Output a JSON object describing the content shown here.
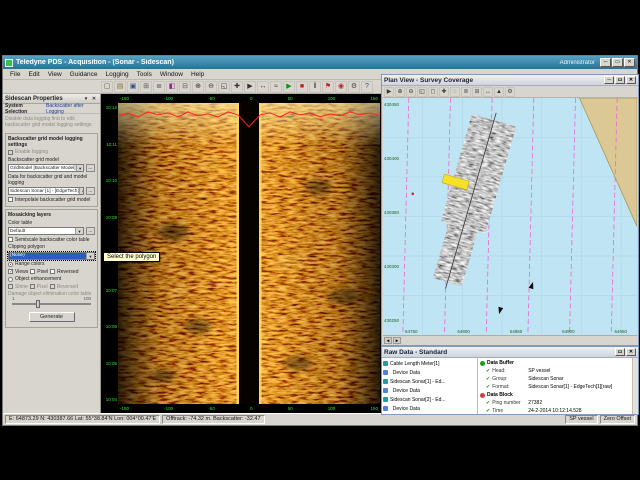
{
  "window": {
    "title": "Teledyne PDS - Acquisition - (Sonar - Sidescan)",
    "user": "Administrator"
  },
  "chrome": {
    "min": "─",
    "max": "▭",
    "close": "✕"
  },
  "menu": {
    "items": [
      "File",
      "Edit",
      "View",
      "Guidance",
      "Logging",
      "Tools",
      "Window",
      "Help"
    ]
  },
  "toolbar": {
    "icons": [
      {
        "name": "new-file-icon",
        "glyph": "▢",
        "color": "#555555"
      },
      {
        "name": "open-file-icon",
        "glyph": "▤",
        "color": "#8a6a20"
      },
      {
        "name": "save-icon",
        "glyph": "▣",
        "color": "#2a4f8a"
      },
      {
        "name": "print-icon",
        "glyph": "⊞",
        "color": "#555555"
      },
      {
        "name": "layers-icon",
        "glyph": "≣",
        "color": "#555555"
      },
      {
        "name": "palette-icon",
        "glyph": "◧",
        "color": "#8a2a8a"
      },
      {
        "name": "grid-icon",
        "glyph": "⊟",
        "color": "#555555"
      },
      {
        "name": "zoom-in-icon",
        "glyph": "⊕",
        "color": "#333333"
      },
      {
        "name": "zoom-out-icon",
        "glyph": "⊖",
        "color": "#333333"
      },
      {
        "name": "zoom-extents-icon",
        "glyph": "◱",
        "color": "#333333"
      },
      {
        "name": "pan-icon",
        "glyph": "✚",
        "color": "#333333"
      },
      {
        "name": "select-icon",
        "glyph": "▶",
        "color": "#333333"
      },
      {
        "name": "measure-icon",
        "glyph": "↔",
        "color": "#333333"
      },
      {
        "name": "profile-icon",
        "glyph": "≈",
        "color": "#333333"
      },
      {
        "name": "start-logging-icon",
        "glyph": "▶",
        "color": "#149114"
      },
      {
        "name": "stop-logging-icon",
        "glyph": "■",
        "color": "#bb2222"
      },
      {
        "name": "pause-logging-icon",
        "glyph": "‖",
        "color": "#333333"
      },
      {
        "name": "event-flag-icon",
        "glyph": "⚑",
        "color": "#bb2222"
      },
      {
        "name": "alarm-icon",
        "glyph": "◉",
        "color": "#bb2222"
      },
      {
        "name": "settings-icon",
        "glyph": "⚙",
        "color": "#444444"
      },
      {
        "name": "help-icon",
        "glyph": "?",
        "color": "#2a4f8a"
      }
    ]
  },
  "properties_panel": {
    "title": "Sidescan Properties",
    "tab_system": "System Selection",
    "tab_backscatter": "Backscatter after Logging",
    "intro": "Disable data logging first to edit backscatter grid model logging settings.",
    "logging_group": {
      "title": "Backscatter grid model logging settings",
      "enable_logging": "Enable logging",
      "model_label": "Backscatter grid model",
      "model_value": "GridModel [Backscatter Model]",
      "model_button": "...",
      "data_label": "Data for backscatter grid and model logging",
      "data_value": "Sidescan Sonar [1] - [EdgeTech]",
      "data_button": "...",
      "interpolate": "Interpolate backscatter grid model"
    },
    "mosaic_group": {
      "title": "Mosaicking layers",
      "color_table_label": "Color table",
      "color_table_value": "Default",
      "color_table_button": "...",
      "semiscale": "Semiscale backscatter color table",
      "clipping_label": "Clipping polygon",
      "clipping_value": "(None)",
      "range_colors": "Range colors",
      "views": "Views",
      "pixel": "Pixel",
      "reversed": "Reversed",
      "object_enhancement": "Object enhancement",
      "shine": "Shine",
      "pixel2": "Pixel",
      "reversed2": "Reversed",
      "damage_label": "Damage object elimination color table",
      "slider_min": "1",
      "slider_max": "100",
      "generate": "Generate"
    }
  },
  "tooltip": {
    "text": "Select the polygon"
  },
  "sidescan": {
    "left_axis": [
      "10:12",
      "10:11",
      "10:10",
      "10:09",
      "10:08",
      "10:07",
      "10:06",
      "10:05",
      "10:04"
    ],
    "top_axis": [
      "-150",
      "-100",
      "-50",
      "0",
      "50",
      "100",
      "150"
    ],
    "bottom_axis": [
      "-150",
      "-100",
      "-50",
      "0",
      "50",
      "100",
      "150"
    ]
  },
  "plan_view": {
    "title": "Plan View - Survey Coverage",
    "icons": [
      {
        "name": "select-icon",
        "glyph": "▶",
        "color": "#333333"
      },
      {
        "name": "zoom-in-icon",
        "glyph": "⊕",
        "color": "#333333"
      },
      {
        "name": "zoom-out-icon",
        "glyph": "⊖",
        "color": "#333333"
      },
      {
        "name": "zoom-window-icon",
        "glyph": "◱",
        "color": "#333333"
      },
      {
        "name": "zoom-extents-icon",
        "glyph": "◻",
        "color": "#333333"
      },
      {
        "name": "pan-icon",
        "glyph": "✚",
        "color": "#333333"
      },
      {
        "name": "redraw-icon",
        "glyph": "◌",
        "color": "#333333"
      },
      {
        "name": "layers-icon",
        "glyph": "≣",
        "color": "#555555"
      },
      {
        "name": "grid-icon",
        "glyph": "⊞",
        "color": "#555555"
      },
      {
        "name": "ruler-icon",
        "glyph": "↔",
        "color": "#333333"
      },
      {
        "name": "north-arrow-icon",
        "glyph": "▲",
        "color": "#333333"
      },
      {
        "name": "settings-icon",
        "glyph": "⚙",
        "color": "#444444"
      }
    ],
    "northings": [
      "430450",
      "430400",
      "430350",
      "430300",
      "430250"
    ],
    "eastings": [
      "64750",
      "64800",
      "64850",
      "64900",
      "64950"
    ],
    "scroll_left": "◄",
    "scroll_right": "►"
  },
  "raw_data": {
    "title": "Raw Data - Standard",
    "tree": [
      {
        "label": "Cable Length Meter[1]",
        "color": "#1f9e9e"
      },
      {
        "label": "  Device Data",
        "color": "#4f81d8"
      },
      {
        "label": "Sidescan Sonar[1] - Ed...",
        "color": "#1f9e9e"
      },
      {
        "label": "  Device Data",
        "color": "#4f81d8"
      },
      {
        "label": "Sidescan Sonar[2] - Ed...",
        "color": "#1f9e9e"
      },
      {
        "label": "  Device Data",
        "color": "#4f81d8"
      }
    ],
    "buffer": {
      "title": "Data Buffer",
      "rows": [
        {
          "k": "Head:",
          "v": "SP vessel"
        },
        {
          "k": "Group:",
          "v": "Sidescan Sonar"
        },
        {
          "k": "Format:",
          "v": "Sidescan Sonar[1] - EdgeTech[1][raw]"
        }
      ]
    },
    "block": {
      "title": "Data Block",
      "rows": [
        {
          "k": "Ping number",
          "v": "27382"
        },
        {
          "k": "Time",
          "v": "24-2-2014 10:12:14.528"
        }
      ]
    }
  },
  "status_bar": {
    "position": "E: 64873.29  N: 430387.66  Lat: 55°38.84'N  Lon: 004°00.47'E",
    "offtrack": "Offtrack: -74.32 m.  Backscatter: -32.47",
    "vessel": "SP vessel",
    "offset": "Zero Offset"
  },
  "colors": {
    "accent_titlebar": "#2b7094",
    "selection_blue": "#2a5fc0",
    "sonar_orange": "#ff9d00",
    "map_water": "#bfe4f4",
    "map_land": "#dcc894",
    "survey_line_magenta": "#ee66cc",
    "axis_green": "#35e035",
    "tooltip_yellow": "#ffffcf"
  }
}
